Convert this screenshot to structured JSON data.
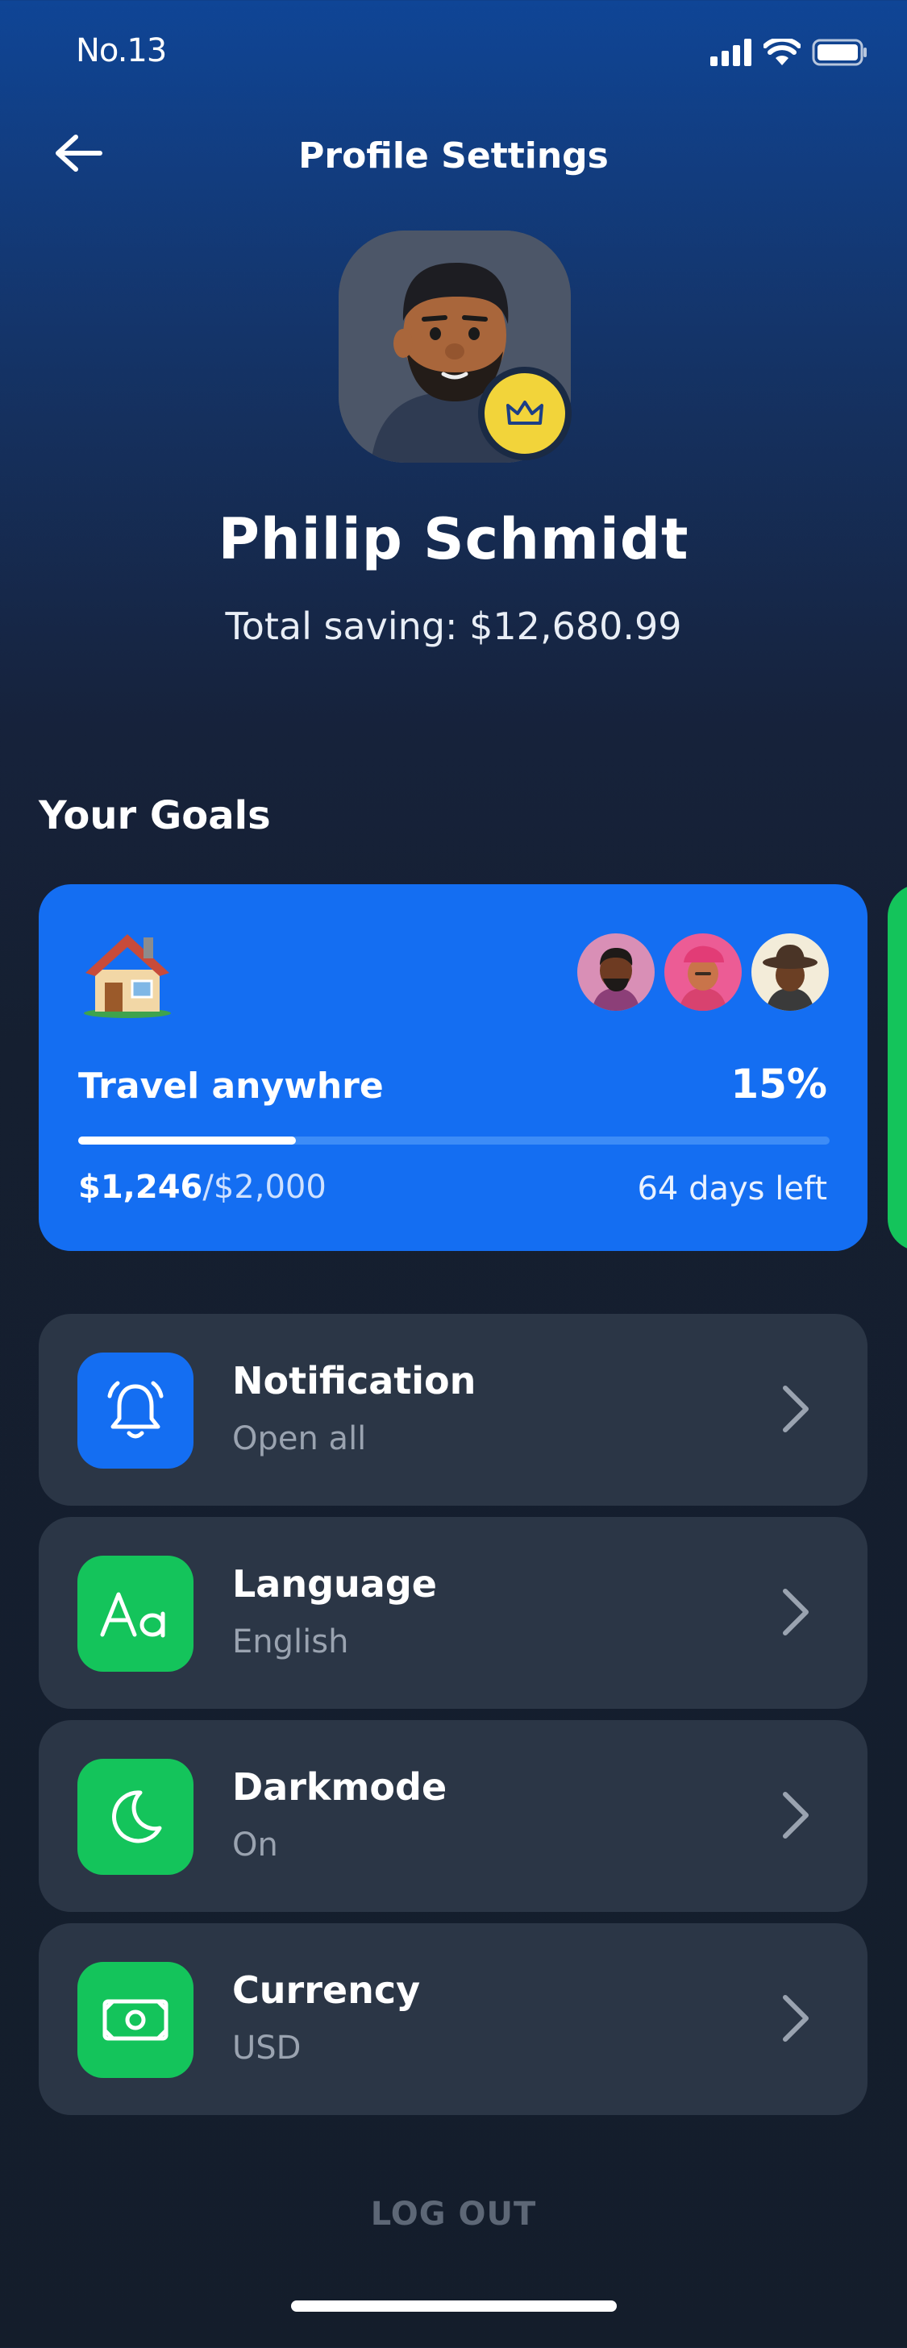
{
  "status_bar": {
    "time": "No.13",
    "icons": [
      "signal-icon",
      "wifi-icon",
      "battery-icon"
    ]
  },
  "header": {
    "title": "Profile Settings",
    "back_icon": "arrow-left-icon"
  },
  "profile": {
    "name": "Philip Schmidt",
    "total_saving": "Total saving: $12,680.99",
    "badge_icon": "crown-icon"
  },
  "goals": {
    "section_title": "Your Goals",
    "cards": [
      {
        "emoji_icon": "house-icon",
        "name": "Travel anywhre",
        "percent": "15%",
        "progress": 0.29,
        "saved": "$1,246",
        "target": "/$2,000",
        "days_left": "64 days left",
        "members": [
          "member-avatar-1",
          "member-avatar-2",
          "member-avatar-3"
        ]
      }
    ]
  },
  "settings": [
    {
      "title": "Notification",
      "subtitle": "Open all",
      "icon": "bell-icon",
      "color": "#146ef2"
    },
    {
      "title": "Language",
      "subtitle": "English",
      "icon": "text-aa-icon",
      "color": "#14c45b"
    },
    {
      "title": "Darkmode",
      "subtitle": "On",
      "icon": "moon-icon",
      "color": "#14c45b"
    },
    {
      "title": "Currency",
      "subtitle": "USD",
      "icon": "banknote-icon",
      "color": "#14c45b"
    }
  ],
  "logout_label": "LOG OUT",
  "colors": {
    "accent_blue": "#146ef2",
    "accent_green": "#14c45b",
    "card_bg": "#2b3646",
    "badge_yellow": "#f2d43a"
  }
}
